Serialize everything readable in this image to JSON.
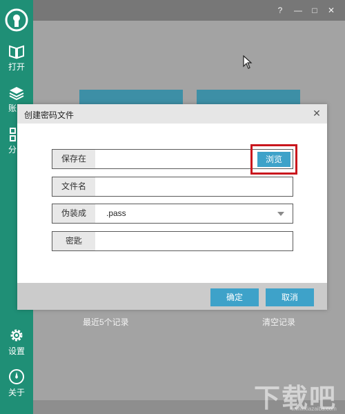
{
  "sidebar": {
    "items": [
      {
        "label": "打开",
        "icon": "book-icon"
      },
      {
        "label": "账",
        "icon": "layers-icon"
      },
      {
        "label": "分",
        "icon": "grid-icon"
      },
      {
        "label": "设置",
        "icon": "gear-icon"
      },
      {
        "label": "关于",
        "icon": "compass-icon"
      }
    ],
    "logo_icon": "keyhole-icon"
  },
  "titlebar": {
    "help": "?",
    "minimize": "—",
    "maximize": "□",
    "close": "✕"
  },
  "main": {
    "recent_label": "最近5个记录",
    "clear_label": "清空记录"
  },
  "dialog": {
    "title": "创建密码文件",
    "close": "✕",
    "fields": {
      "save_location": {
        "label": "保存在",
        "value": ""
      },
      "file_name": {
        "label": "文件名",
        "value": ""
      },
      "disguise": {
        "label": "伪装成",
        "value": ".pass"
      },
      "key": {
        "label": "密匙",
        "value": ""
      }
    },
    "browse_label": "浏览",
    "confirm_label": "确定",
    "cancel_label": "取消"
  },
  "watermark": {
    "text": "下载吧",
    "sub": "www.xiazaiba.com"
  },
  "colors": {
    "sidebar": "#1f8f76",
    "accent_button": "#3ea2c9",
    "highlight_box": "#c9161d"
  }
}
